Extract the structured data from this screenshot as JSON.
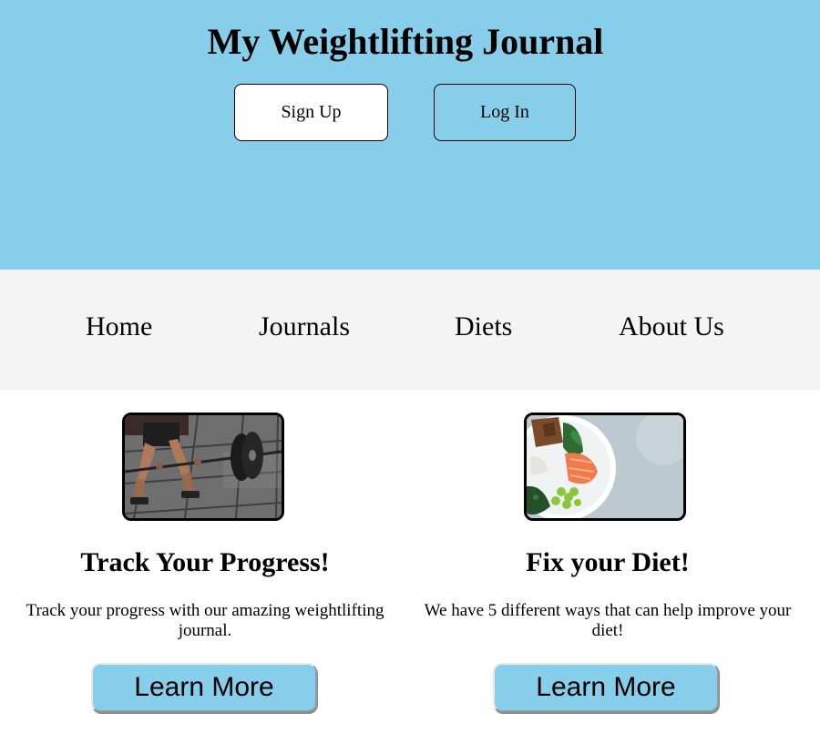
{
  "header": {
    "title": "My Weightlifting Journal",
    "signup_label": "Sign Up",
    "login_label": "Log In",
    "background_color": "#87ceeb"
  },
  "nav": {
    "items": [
      {
        "label": "Home"
      },
      {
        "label": "Journals"
      },
      {
        "label": "Diets"
      },
      {
        "label": "About Us"
      }
    ],
    "background_color": "#f4f4f4"
  },
  "features": [
    {
      "image": "deadlift-barbell-photo",
      "title": "Track Your Progress!",
      "text": "Track your progress with our amazing weightlifting journal.",
      "button_label": "Learn More"
    },
    {
      "image": "healthy-food-bowl-photo",
      "title": "Fix your Diet!",
      "text": "We have 5 different ways that can help improve your diet!",
      "button_label": "Learn More"
    }
  ],
  "colors": {
    "accent": "#87ceeb",
    "text": "#000000"
  }
}
